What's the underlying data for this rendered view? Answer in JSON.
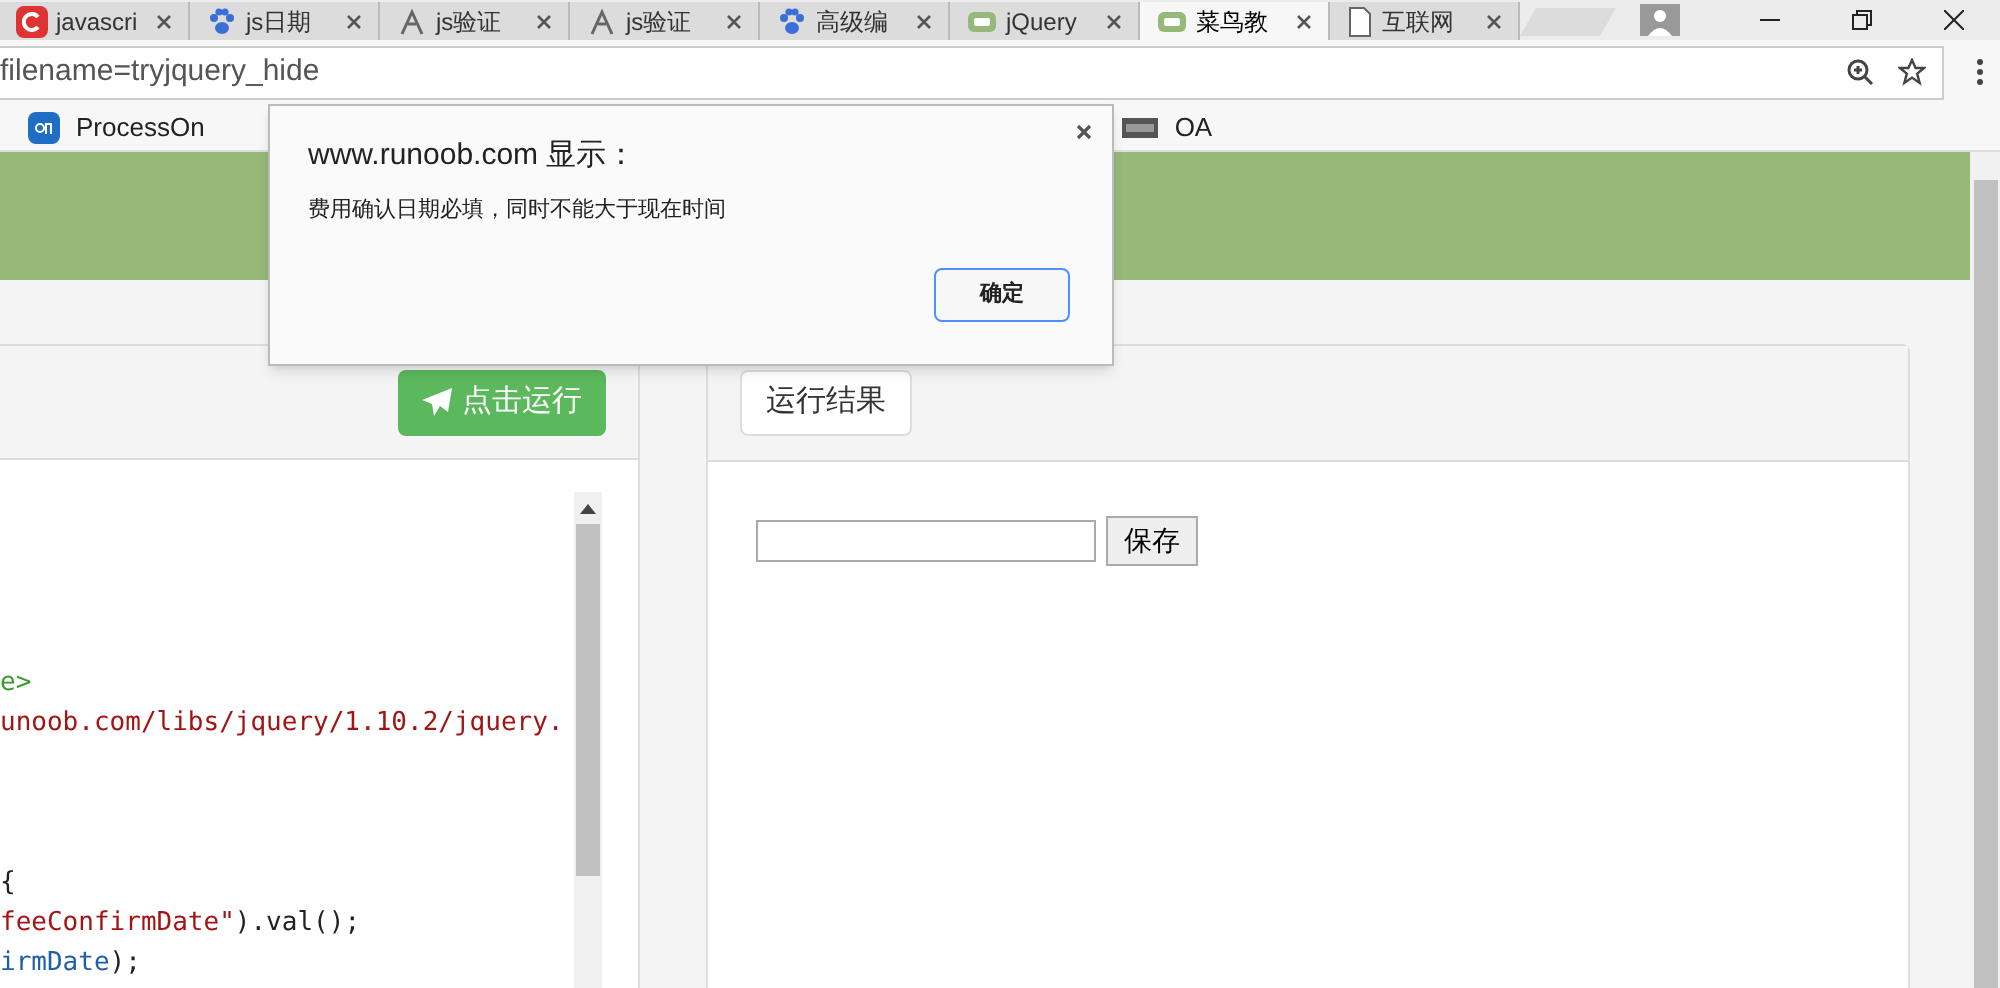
{
  "browser_tabs": [
    {
      "label": "javascri",
      "kind": "c",
      "selected": false
    },
    {
      "label": "js日期",
      "kind": "paw",
      "selected": false
    },
    {
      "label": "js验证",
      "kind": "fork",
      "selected": false
    },
    {
      "label": "js验证",
      "kind": "fork",
      "selected": false
    },
    {
      "label": "高级编",
      "kind": "paw",
      "selected": false
    },
    {
      "label": "jQuery",
      "kind": "runoob",
      "selected": false
    },
    {
      "label": "菜鸟教",
      "kind": "runoob",
      "selected": true
    },
    {
      "label": "互联网",
      "kind": "page",
      "selected": false
    }
  ],
  "address_bar": {
    "value": "filename=tryjquery_hide"
  },
  "bookmarks": [
    {
      "label": "ProcessOn",
      "kind": "on"
    },
    {
      "label": "OA",
      "kind": "docs"
    }
  ],
  "editor": {
    "run_button": "点击运行",
    "code_blocks": [
      [
        [
          {
            "text": "e>",
            "kind": "tag"
          }
        ],
        [
          {
            "text": "unoob.com/libs/jquery/1.10.2/jquery.",
            "kind": "string"
          }
        ]
      ],
      [
        [
          {
            "text": "{",
            "kind": "plain"
          }
        ],
        [
          {
            "text": "feeConfirmDate\"",
            "kind": "string"
          },
          {
            "text": ").val();",
            "kind": "plain"
          }
        ],
        [
          {
            "text": "irmDate",
            "kind": "variable"
          },
          {
            "text": ");",
            "kind": "plain"
          }
        ]
      ]
    ]
  },
  "result": {
    "tab": "运行结果",
    "save_button": "保存"
  },
  "dialog": {
    "title": "www.runoob.com 显示：",
    "message": "费用确认日期必填，同时不能大于现在时间",
    "ok_button": "确定"
  }
}
